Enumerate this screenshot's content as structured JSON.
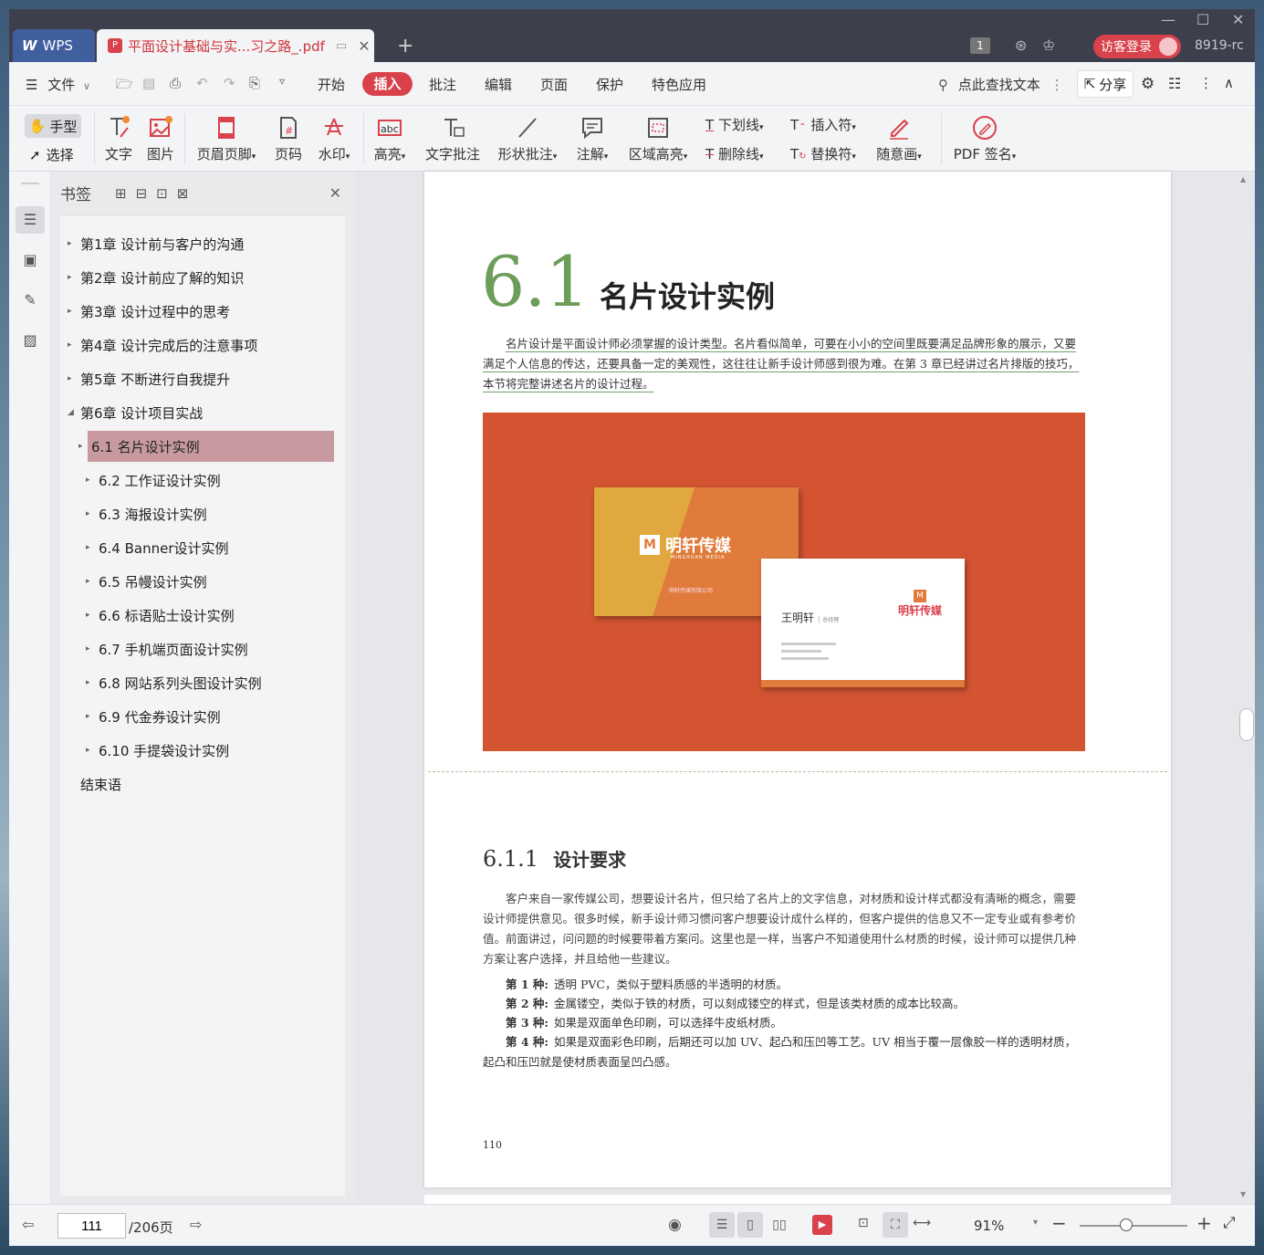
{
  "titlebar": {
    "app_tab": "WPS",
    "doc_tab": "平面设计基础与实...习之路_.pdf",
    "page_badge": "1",
    "login_button": "访客登录",
    "user_code": "8919-rc"
  },
  "menubar": {
    "file": "文件",
    "items": [
      "开始",
      "插入",
      "批注",
      "编辑",
      "页面",
      "保护",
      "特色应用"
    ],
    "active": "插入",
    "search": "点此查找文本",
    "share": "分享"
  },
  "ribbon": {
    "hand": "手型",
    "select": "选择",
    "text": "文字",
    "image": "图片",
    "header_footer": "页眉页脚",
    "page_num": "页码",
    "watermark": "水印",
    "highlight": "高亮",
    "text_comment": "文字批注",
    "shape_comment": "形状批注",
    "note": "注解",
    "area_highlight": "区域高亮",
    "underline": "下划线",
    "strikethrough": "删除线",
    "insert_mark": "插入符",
    "replace_mark": "替换符",
    "freehand": "随意画",
    "pdf_sign": "PDF 签名"
  },
  "bookmarks": {
    "title": "书签",
    "items": [
      {
        "label": "第1章 设计前与客户的沟通",
        "level": 0
      },
      {
        "label": "第2章 设计前应了解的知识",
        "level": 0
      },
      {
        "label": "第3章 设计过程中的思考",
        "level": 0
      },
      {
        "label": "第4章 设计完成后的注意事项",
        "level": 0
      },
      {
        "label": "第5章 不断进行自我提升",
        "level": 0
      },
      {
        "label": "第6章 设计项目实战",
        "level": 0
      },
      {
        "label": "6.1 名片设计实例",
        "level": 1
      },
      {
        "label": "6.2 工作证设计实例",
        "level": 1
      },
      {
        "label": "6.3 海报设计实例",
        "level": 1
      },
      {
        "label": "6.4 Banner设计实例",
        "level": 1
      },
      {
        "label": "6.5 吊幔设计实例",
        "level": 1
      },
      {
        "label": "6.6 标语贴士设计实例",
        "level": 1
      },
      {
        "label": "6.7 手机端页面设计实例",
        "level": 1
      },
      {
        "label": "6.8 网站系列头图设计实例",
        "level": 1
      },
      {
        "label": "6.9 代金券设计实例",
        "level": 1
      },
      {
        "label": "6.10 手提袋设计实例",
        "level": 1
      },
      {
        "label": "结束语",
        "level": 0
      }
    ],
    "selected": "6.1 名片设计实例"
  },
  "document": {
    "section_number": "6.1",
    "section_title": "名片设计实例",
    "intro": "名片设计是平面设计师必须掌握的设计类型。名片看似简单，可要在小小的空间里既要满足品牌形象的展示，又要满足个人信息的传达，还要具备一定的美观性，这往往让新手设计师感到很为难。在第 3 章已经讲过名片排版的技巧，本节将完整讲述名片的设计过程。",
    "card": {
      "brand_cn": "明轩传媒",
      "brand_en": "MINGXUAN MEDIA",
      "company": "明轩传媒有限公司",
      "person": "王明轩",
      "role": "总经理"
    },
    "subsection_number": "6.1.1",
    "subsection_title": "设计要求",
    "body": "客户来自一家传媒公司，想要设计名片，但只给了名片上的文字信息，对材质和设计样式都没有清晰的概念，需要设计师提供意见。很多时候，新手设计师习惯问客户想要设计成什么样的，但客户提供的信息又不一定专业或有参考价值。前面讲过，问问题的时候要带着方案问。这里也是一样，当客户不知道使用什么材质的时候，设计师可以提供几种方案让客户选择，并且给他一些建议。",
    "options": [
      {
        "label": "第 1 种:",
        "text": "透明 PVC，类似于塑料质感的半透明的材质。"
      },
      {
        "label": "第 2 种:",
        "text": "金属镂空，类似于铁的材质，可以刻成镂空的样式，但是该类材质的成本比较高。"
      },
      {
        "label": "第 3 种:",
        "text": "如果是双面单色印刷，可以选择牛皮纸材质。"
      },
      {
        "label": "第 4 种:",
        "text": "如果是双面彩色印刷，后期还可以加 UV、起凸和压凹等工艺。UV 相当于覆一层像胶一样的透明材质，起凸和压凹就是使材质表面呈凹凸感。"
      }
    ],
    "page_number": "110"
  },
  "statusbar": {
    "current_page": "111",
    "total_pages": "/206页",
    "zoom": "91%"
  },
  "colors": {
    "accent": "#d9414b",
    "selected_bookmark": "#c89aa0",
    "section_green": "#6e9d5a",
    "card_bg": "#d45432"
  }
}
